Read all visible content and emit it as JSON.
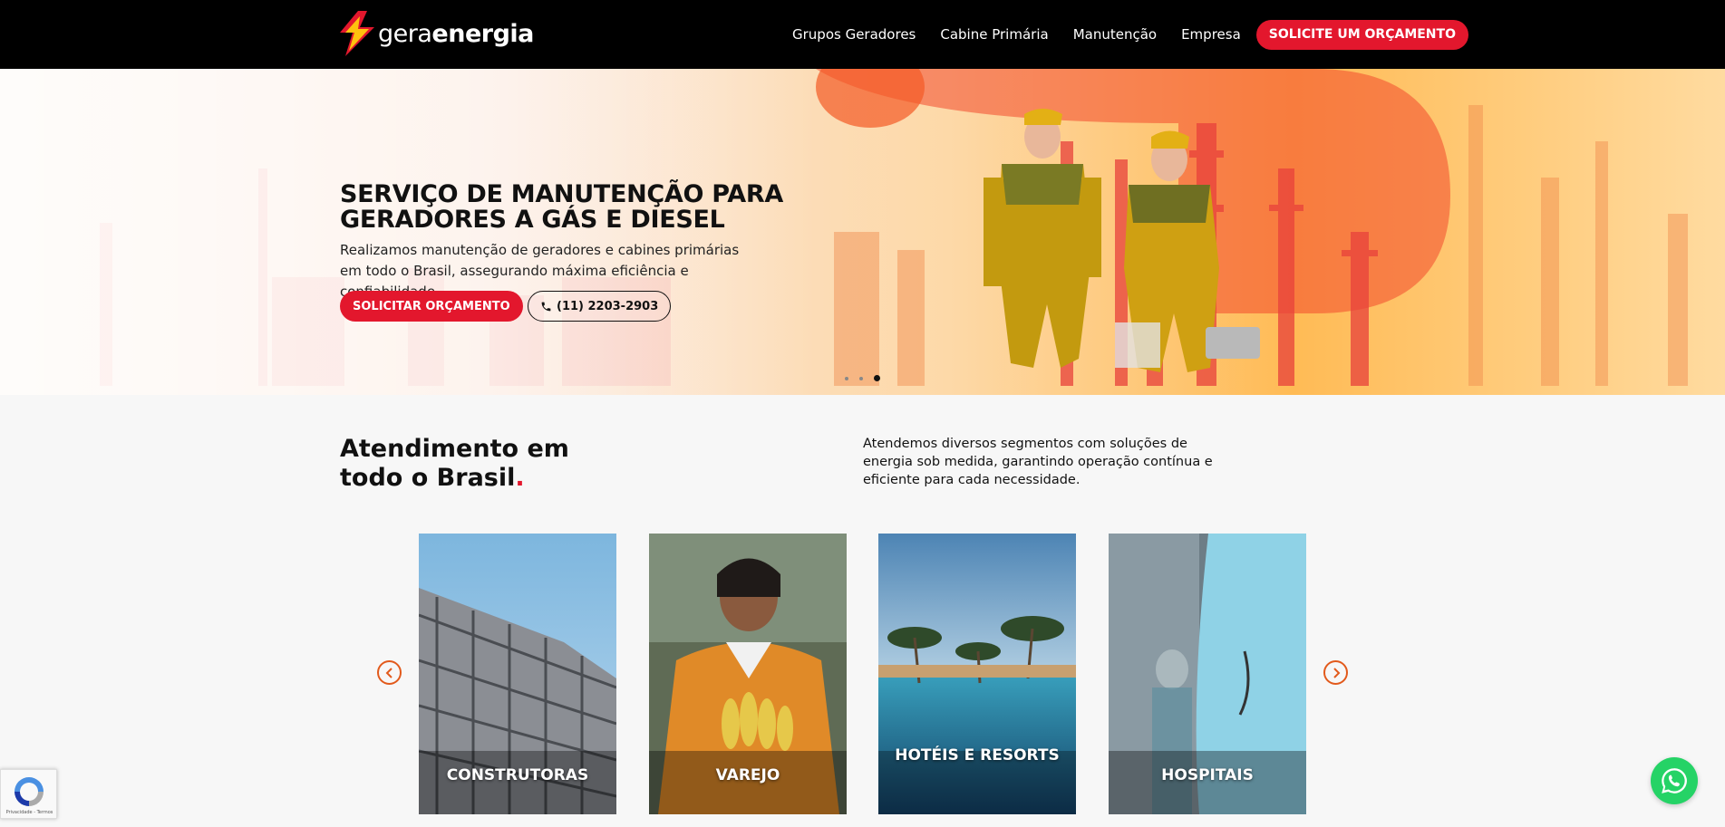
{
  "header": {
    "logo": {
      "light": "gera",
      "bold": "energia"
    },
    "nav": [
      "Grupos Geradores",
      "Cabine Primária",
      "Manutenção",
      "Empresa"
    ],
    "cta": "SOLICITE UM ORÇAMENTO"
  },
  "hero": {
    "title": "SERVIÇO DE MANUTENÇÃO PARA GERADORES A GÁS E DIESEL",
    "description": "Realizamos manutenção de geradores e cabines primárias em todo o Brasil, assegurando máxima eficiência e confiabilidade.",
    "primary_button": "SOLICITAR ORÇAMENTO",
    "phone_button": "(11) 2203-2903",
    "slides_total": 3,
    "active_slide": 3
  },
  "segments": {
    "title_line1": "Atendimento em",
    "title_line2": "todo o Brasil",
    "title_dot": ".",
    "description": "Atendemos diversos segmentos com soluções de energia sob medida, garantindo operação contínua e eficiente para cada necessidade.",
    "cards": [
      {
        "label": "CONSTRUTORAS"
      },
      {
        "label": "VAREJO"
      },
      {
        "label": "HOTÉIS E RESORTS"
      },
      {
        "label": "HOSPITAIS"
      }
    ]
  },
  "widgets": {
    "recaptcha_text": "Privacidade - Termos",
    "whatsapp_icon": "whatsapp-icon"
  },
  "colors": {
    "brand_red": "#e3172d",
    "brand_yellow": "#ffc20e",
    "arrow_orange": "#e25a1c",
    "header_bg": "#000000"
  }
}
